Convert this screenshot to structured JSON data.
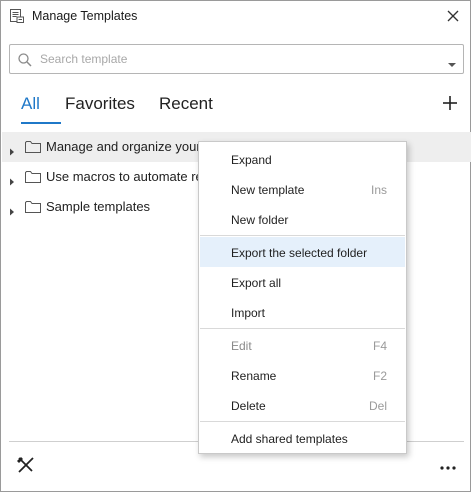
{
  "window": {
    "title": "Manage Templates"
  },
  "search": {
    "placeholder": "Search template",
    "value": ""
  },
  "tabs": [
    {
      "label": "All",
      "active": true
    },
    {
      "label": "Favorites",
      "active": false
    },
    {
      "label": "Recent",
      "active": false
    }
  ],
  "tree": [
    {
      "label": "Manage and organize your templates",
      "icon": "folder-icon",
      "highlighted": true
    },
    {
      "label": "Use macros to automate repetitive tasks",
      "icon": "folder-icon",
      "highlighted": false
    },
    {
      "label": "Sample templates",
      "icon": "folder-icon",
      "highlighted": false
    }
  ],
  "context_menu": {
    "items": [
      {
        "label": "Expand",
        "shortcut": ""
      },
      {
        "label": "New template",
        "shortcut": "Ins"
      },
      {
        "label": "New folder",
        "shortcut": ""
      },
      {
        "label": "Export the selected folder",
        "shortcut": "",
        "hovered": true
      },
      {
        "label": "Export all",
        "shortcut": ""
      },
      {
        "label": "Import",
        "shortcut": ""
      },
      {
        "label": "Edit",
        "shortcut": "F4",
        "disabled": true
      },
      {
        "label": "Rename",
        "shortcut": "F2"
      },
      {
        "label": "Delete",
        "shortcut": "Del"
      },
      {
        "label": "Add shared templates",
        "shortcut": ""
      }
    ]
  },
  "colors": {
    "accent": "#1f78c8",
    "menu_hover": "#e5f0fb",
    "row_highlight": "#eeeeee"
  },
  "icons": {
    "title": "templates-icon",
    "close": "close-icon",
    "search": "search-icon",
    "dropdown": "dropdown-arrow-icon",
    "add": "plus-icon",
    "tools": "tools-icon",
    "more": "more-icon"
  }
}
